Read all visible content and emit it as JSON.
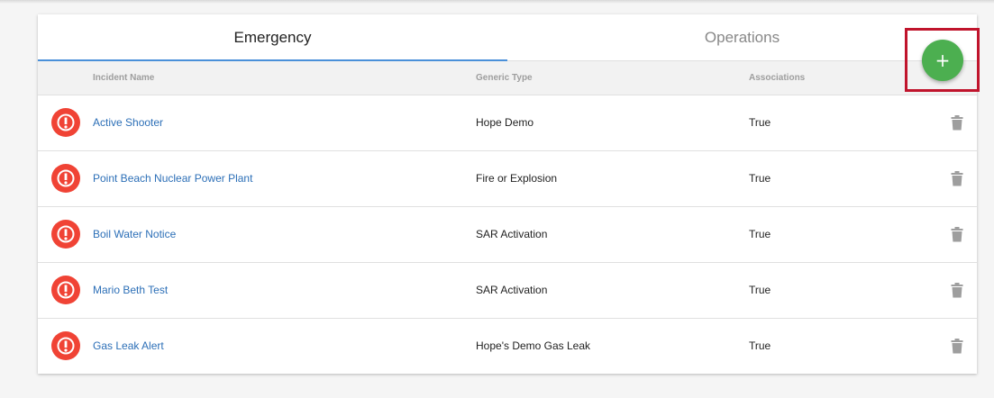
{
  "tabs": [
    {
      "label": "Emergency",
      "active": true
    },
    {
      "label": "Operations",
      "active": false
    }
  ],
  "table": {
    "columns": [
      "Incident Name",
      "Generic Type",
      "Associations"
    ],
    "rows": [
      {
        "name": "Active Shooter",
        "type": "Hope Demo",
        "associations": "True"
      },
      {
        "name": "Point Beach Nuclear Power Plant",
        "type": "Fire or Explosion",
        "associations": "True"
      },
      {
        "name": "Boil Water Notice",
        "type": "SAR Activation",
        "associations": "True"
      },
      {
        "name": "Mario Beth Test",
        "type": "SAR Activation",
        "associations": "True"
      },
      {
        "name": "Gas Leak Alert",
        "type": "Hope's Demo Gas Leak",
        "associations": "True"
      }
    ]
  },
  "add_button": {
    "label": "+"
  },
  "icons": {
    "row_status": "alert-icon",
    "row_action": "trash-icon"
  },
  "colors": {
    "accent": "#4a90d9",
    "add": "#4caf50",
    "alert": "#f04335",
    "link": "#2c6fb7",
    "highlight": "#c0142c"
  }
}
